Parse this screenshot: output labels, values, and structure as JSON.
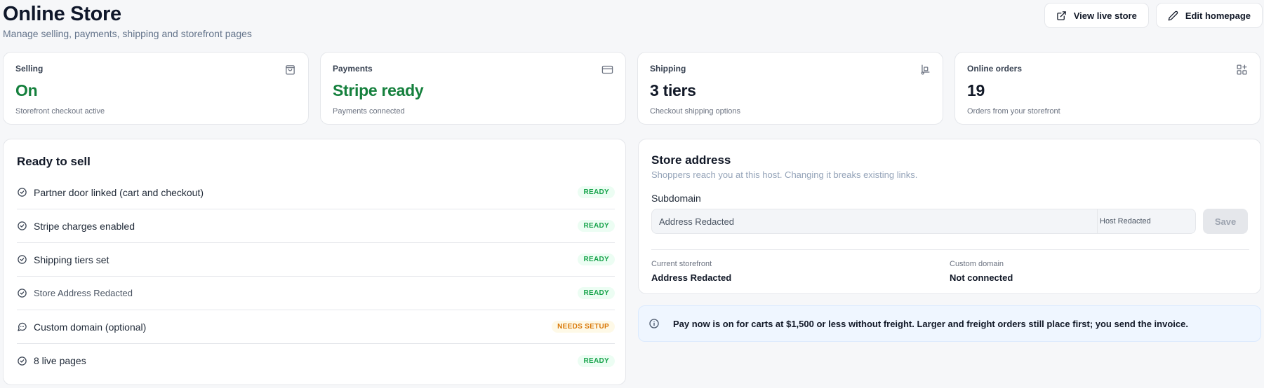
{
  "header": {
    "title": "Online Store",
    "subtitle": "Manage selling, payments, shipping and storefront pages",
    "view_live_label": "View live store",
    "edit_homepage_label": "Edit homepage"
  },
  "stats": [
    {
      "label": "Selling",
      "value": "On",
      "sub": "Storefront checkout active",
      "icon": "shopping-bag-icon",
      "accent": "#15803d"
    },
    {
      "label": "Payments",
      "value": "Stripe ready",
      "sub": "Payments connected",
      "icon": "credit-card-icon",
      "accent": "#15803d"
    },
    {
      "label": "Shipping",
      "value": "3 tiers",
      "sub": "Checkout shipping options",
      "icon": "hand-truck-icon",
      "accent": "#111827"
    },
    {
      "label": "Online orders",
      "value": "19",
      "sub": "Orders from your storefront",
      "icon": "grid-plus-icon",
      "accent": "#111827"
    }
  ],
  "ready": {
    "title": "Ready to sell",
    "items": [
      {
        "label": "Partner door linked (cart and checkout)",
        "status": "READY",
        "icon": "check-circle-icon"
      },
      {
        "label": "Stripe charges enabled",
        "status": "READY",
        "icon": "check-circle-icon"
      },
      {
        "label": "Shipping tiers set",
        "status": "READY",
        "icon": "check-circle-icon"
      },
      {
        "label": "Store Address Redacted",
        "status": "READY",
        "icon": "check-circle-icon"
      },
      {
        "label": "Custom domain (optional)",
        "status": "NEEDS SETUP",
        "icon": "message-circle-icon"
      },
      {
        "label": "8 live pages",
        "status": "READY",
        "icon": "check-circle-icon"
      }
    ]
  },
  "address": {
    "title": "Store address",
    "description": "Shoppers reach you at this host. Changing it breaks existing links.",
    "subdomain_label": "Subdomain",
    "subdomain_value": "Address Redacted",
    "host_suffix": "Host Redacted",
    "save_label": "Save",
    "current_label": "Current storefront",
    "current_value": "Address Redacted",
    "custom_label": "Custom domain",
    "custom_value": "Not connected"
  },
  "banner": {
    "text": "Pay now is on for carts at $1,500 or less without freight. Larger and freight orders still place first; you send the invoice.",
    "icon": "info-circle-icon"
  },
  "colors": {
    "ready_green": "#16a34a",
    "setup_amber": "#d97706",
    "stat_green": "#15803d"
  }
}
